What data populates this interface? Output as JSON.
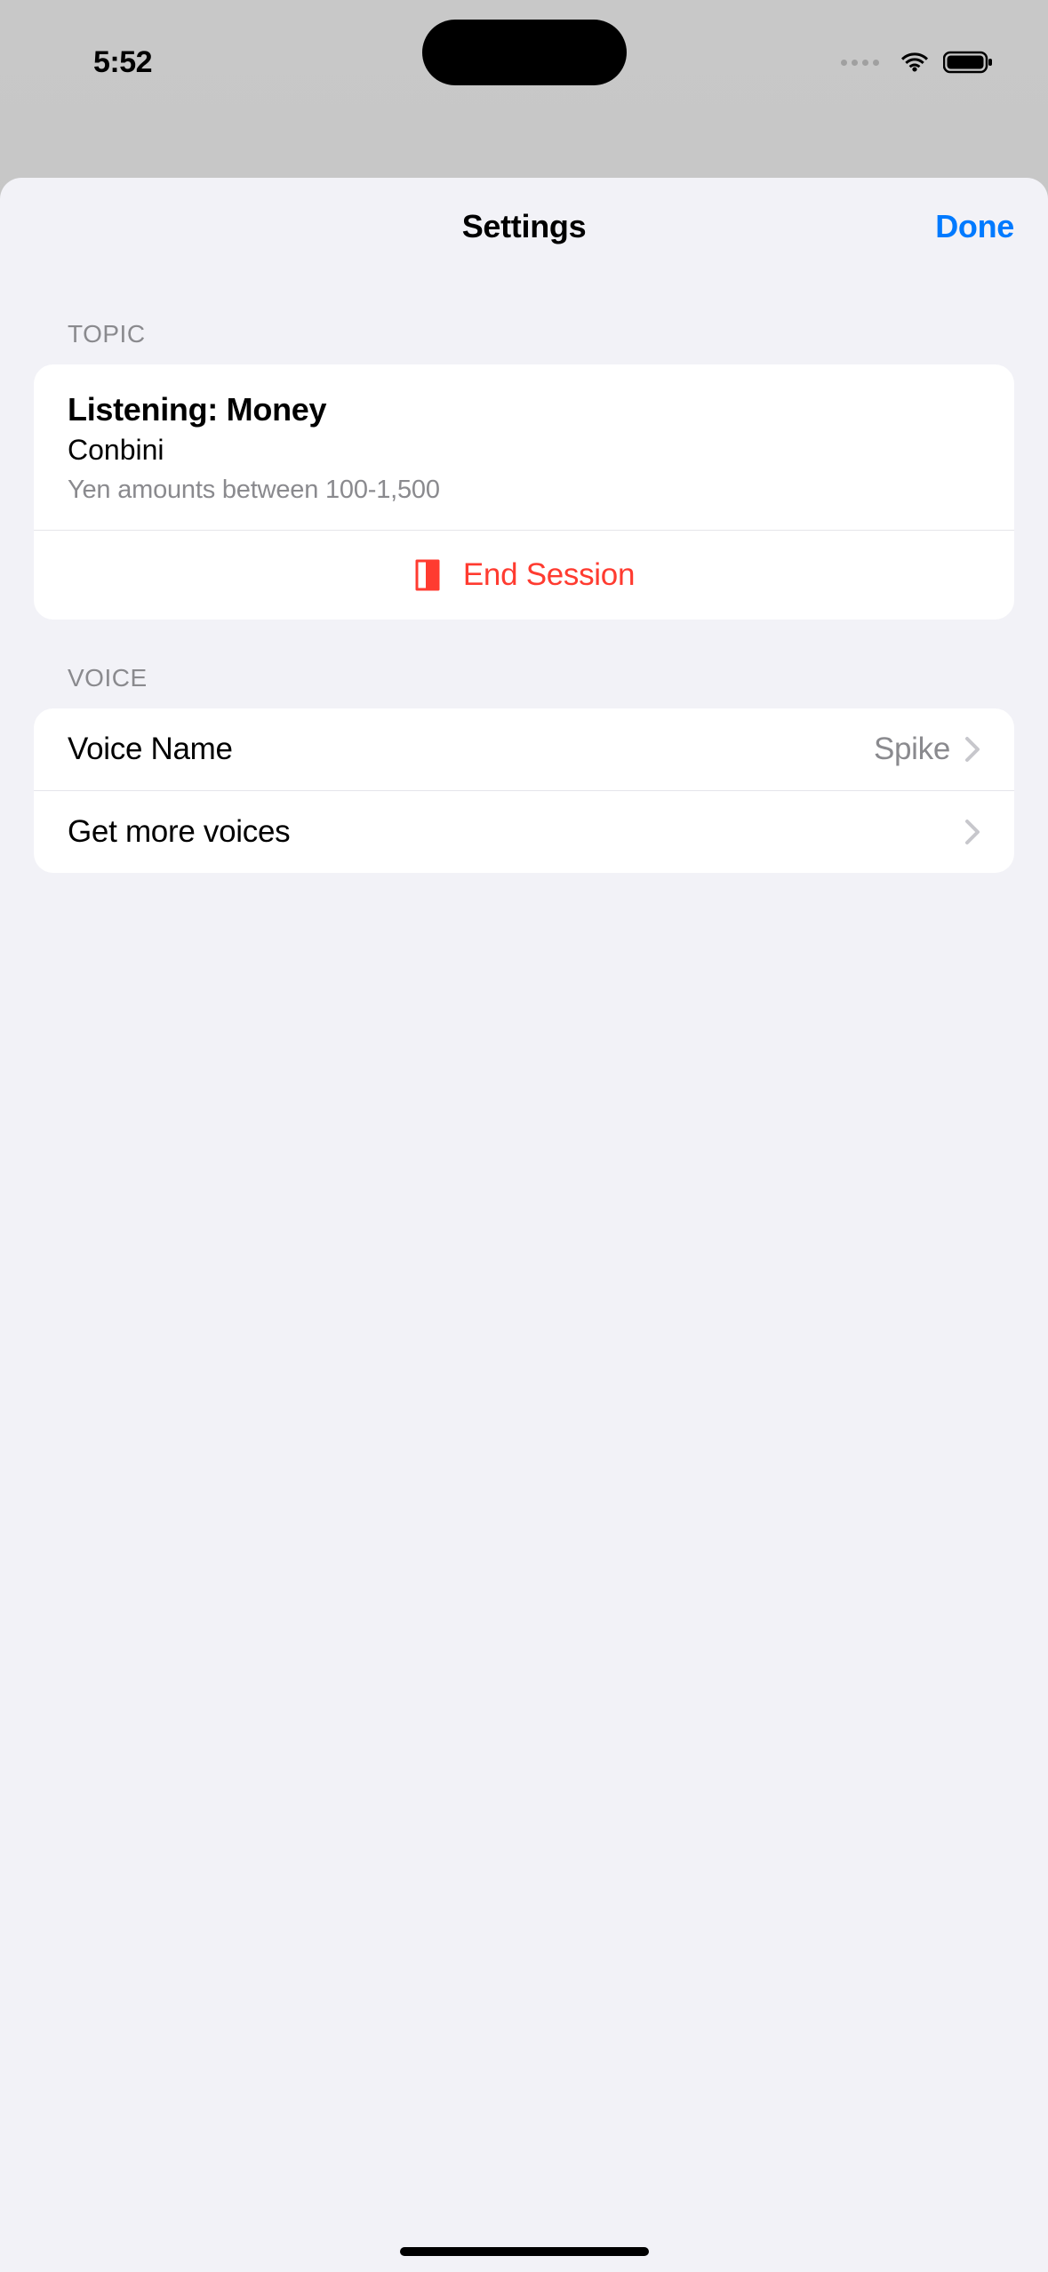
{
  "status": {
    "time": "5:52"
  },
  "sheet": {
    "title": "Settings",
    "done_label": "Done"
  },
  "topic_section": {
    "header": "TOPIC",
    "title": "Listening: Money",
    "subtitle": "Conbini",
    "description": "Yen amounts between 100-1,500",
    "end_session_label": "End Session"
  },
  "voice_section": {
    "header": "VOICE",
    "voice_name_label": "Voice Name",
    "voice_name_value": "Spike",
    "get_more_label": "Get more voices"
  }
}
